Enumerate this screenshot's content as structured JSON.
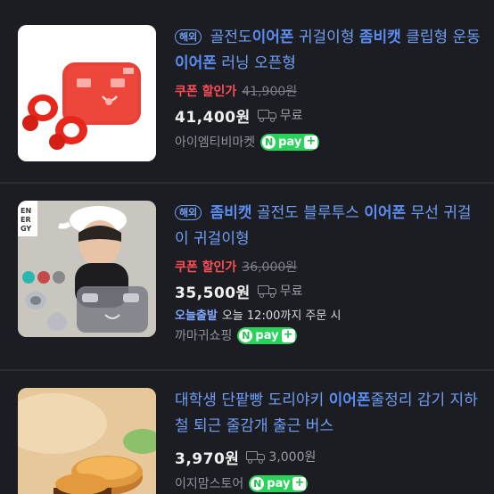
{
  "products": [
    {
      "tag": "해외",
      "title_parts": [
        {
          "text": "골전도",
          "hl": false
        },
        {
          "text": "이어폰",
          "hl": true
        },
        {
          "text": "귀걸이형",
          "hl": false
        },
        {
          "text": "좀비캣",
          "hl": true
        },
        {
          "text": "클립형 운동",
          "hl": false
        },
        {
          "text": "이어폰",
          "hl": true
        },
        {
          "text": "러닝 오픈형",
          "hl": false
        }
      ],
      "coupon_label": "쿠폰 할인가",
      "original_price": "41,900원",
      "price": "41,400원",
      "shipping": "무료",
      "seller": "아이엠티비마켓",
      "npay": {
        "n": "N",
        "pay": "pay",
        "plus": "+"
      }
    },
    {
      "tag": "해외",
      "title_parts": [
        {
          "text": "좀비캣",
          "hl": true
        },
        {
          "text": "골전도 블루투스",
          "hl": false
        },
        {
          "text": "이어폰",
          "hl": true
        },
        {
          "text": "무선 귀걸이 귀걸이형",
          "hl": false
        }
      ],
      "coupon_label": "쿠폰 할인가",
      "original_price": "36,000원",
      "price": "35,500원",
      "shipping": "무료",
      "delivery_badge": "오늘출발",
      "delivery_text": "오늘 12:00까지 주문 시",
      "seller": "까마귀쇼핑",
      "npay": {
        "n": "N",
        "pay": "pay",
        "plus": "+"
      }
    },
    {
      "title_parts": [
        {
          "text": "대학생 단팥빵 도리야키",
          "hl": false
        },
        {
          "text": "이어폰",
          "hl": true
        },
        {
          "text": "줄정리 감기 지하철 퇴근 줄감개 출근 버스",
          "hl": false
        }
      ],
      "price": "3,970원",
      "shipping": "3,000원",
      "seller": "이지맘스토어",
      "npay": {
        "n": "N",
        "pay": "pay",
        "plus": "+"
      }
    }
  ],
  "colors": {
    "background": "#1c1d22",
    "title_link": "#6f9ef5",
    "coupon_red": "#ff4d57",
    "npay_green": "#2ad15b",
    "today_blue": "#7fa7ff"
  }
}
